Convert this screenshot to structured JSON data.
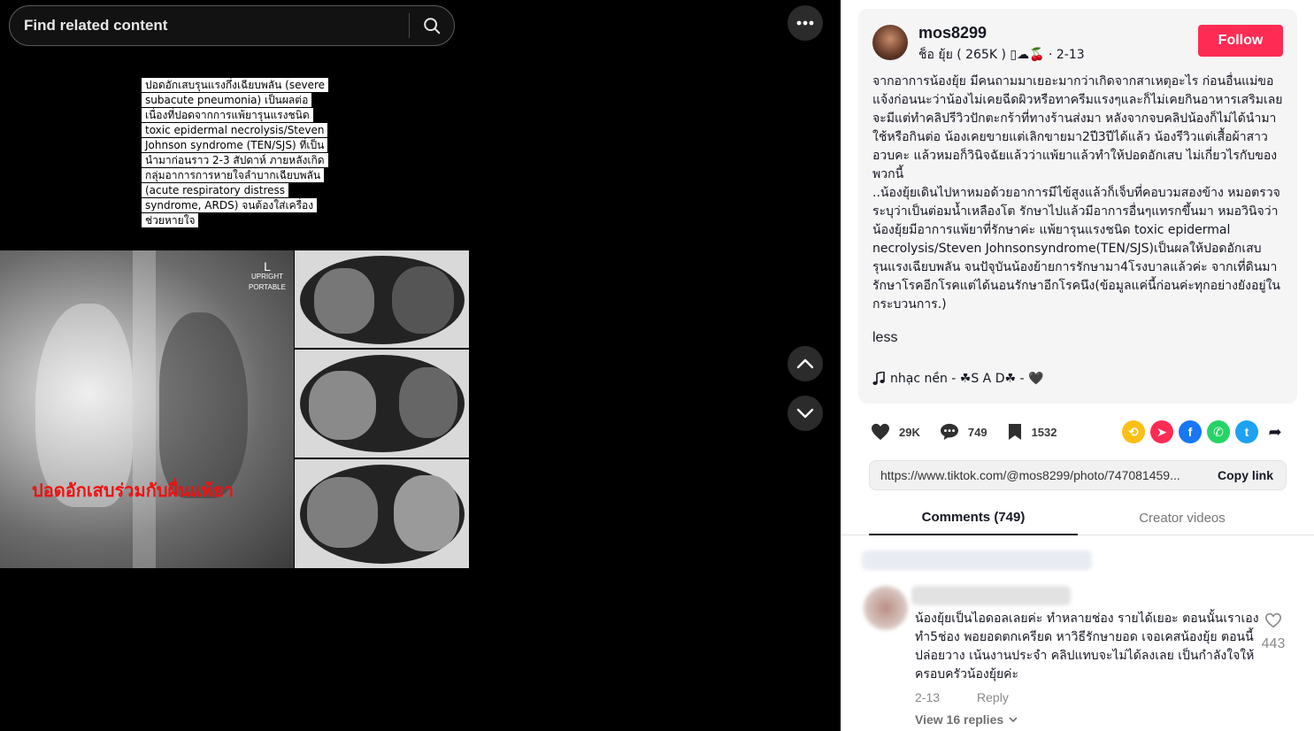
{
  "search": {
    "placeholder": "Find related content"
  },
  "media": {
    "overlay_text": "ปอดอักเสบรุนแรงกึ่งเฉียบพลัน (severe subacute pneumonia) เป็นผลต่อเนื่องที่ปอดจากการแพ้ยารุนแรงชนิด toxic epidermal necrolysis/Steven Johnson syndrome (TEN/SJS) ที่เป็นนำมาก่อนราว 2-3 สัปดาห์ ภายหลังเกิดกลุ่มอาการการหายใจลำบากเฉียบพลัน (acute respiratory distress syndrome, ARDS) จนต้องใส่เครื่องช่วยหายใจ",
    "xray_marker": "L",
    "xray_marker_sub": "UPRIGHT PORTABLE",
    "caption": "ปอดอักเสบร่วมกับผื่นแพ้ยา"
  },
  "author": {
    "username": "mos8299",
    "subtitle": "ช็อ ยุ้ย ( 265K ) ▯☁🍒 · 2-13",
    "follow_label": "Follow"
  },
  "post": {
    "description": "จากอาการน้องยุ้ย มีคนถามมาเยอะมากว่าเกิดจากสาเหตุอะไร ก่อนอื่นแม่ขอแจ้งก่อนนะว่าน้องไม่เคยฉีดผิวหรือทาครีมแรงๆและก็ไม่เคยกินอาหารเสริมเลย จะมีแต่ทำคลิปรีวิวปักตะกร้าที่ทางร้านส่งมา หลังจากจบคลิปน้องก็ไม่ได้นำมาใช้หรือกินต่อ น้องเคยขายแต่เลิกขายมา2ปี3ปีได้แล้ว น้องรีวิวแต่เสื้อผ้าสาวอวบคะ แล้วหมอก็วินิจฉัยแล้วว่าแพ้ยาแล้วทำให้ปอดอักเสบ ไม่เกี่ยวไรกับของพวกนี้\n..น้องยุ้ยเดินไปหาหมอด้วยอาการมีไข้สูงแล้วก็เจ็บที่คอบวมสองข้าง หมอตรวจระบุว่าเป็นต่อมน้ำเหลืองโต รักษาไปแล้วมีอาการอื่นๆแทรกขึ้นมา หมอวินิจว่าน้องยุ้ยมีอาการแพ้ยาที่รักษาค่ะ แพ้ยารุนแรงชนิด toxic epidermal necrolysis/Steven Johnsonsyndrome(TEN/SJS)เป็นผลให้ปอดอักเสบรุนแรงเฉียบพลัน จนปัจุบันน้องย้ายการรักษามา4โรงบาลแล้วค่ะ จากเที่ดินมารักษาโรคอีกโรคแต่ได้นอนรักษาอีกโรคนึง(ข้อมูลแค่นี้ก่อนค่ะทุกอย่างยังอยู่ในกระบวนการ.)",
    "less_label": "less",
    "music": "nhạc nền - ☘S A D☘ - 🖤"
  },
  "actions": {
    "likes": "29K",
    "comments": "749",
    "saves": "1532"
  },
  "share": {
    "url": "https://www.tiktok.com/@mos8299/photo/747081459...",
    "copy_label": "Copy link"
  },
  "tabs": [
    {
      "label": "Comments (749)"
    },
    {
      "label": "Creator videos"
    }
  ],
  "comment": {
    "text": "น้องยุ้ยเป็นไอดอลเลยค่ะ ทำหลายช่อง รายได้เยอะ ตอนนั้นเราเองทำ5ช่อง พอยอดตกเครียด หาวิธีรักษายอด เจอเคสน้องยุ้ย ตอนนี้ปล่อยวาง เน้นงานประจำ คลิปแทบจะไม่ได้ลงเลย เป็นกำลังใจให้ครอบครัวน้องยุ้ยค่ะ",
    "likes": "443",
    "date": "2-13",
    "reply_label": "Reply",
    "view_replies": "View 16 replies"
  },
  "colors": {
    "follow": "#fe2c55",
    "stage": "#000000",
    "caption": "#ee1111"
  }
}
